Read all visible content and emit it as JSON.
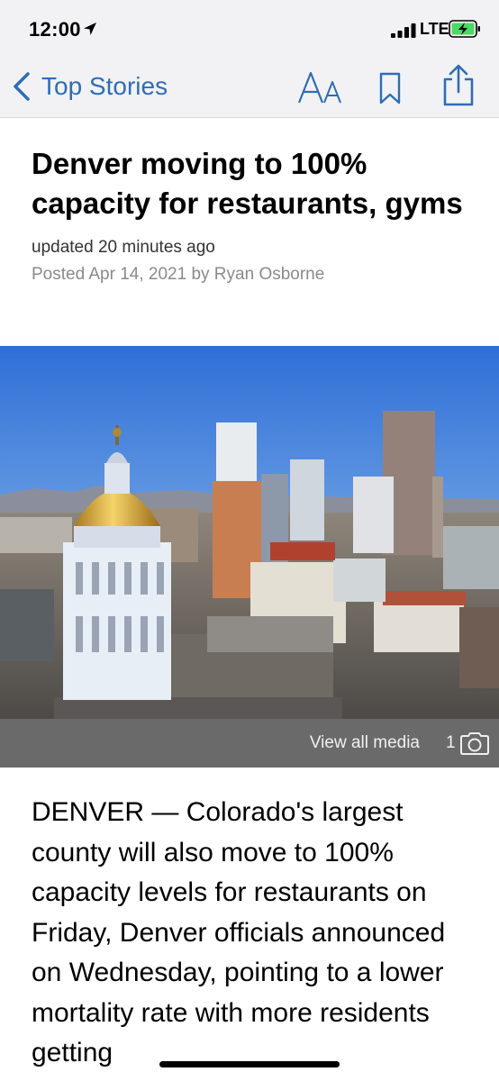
{
  "status_bar": {
    "time": "12:00",
    "network": "LTE",
    "icons": [
      "location-arrow-icon",
      "signal-icon",
      "battery-charging-icon"
    ]
  },
  "nav": {
    "back_label": "Top Stories",
    "font_size_label": "AA",
    "icons": [
      "chevron-left-icon",
      "font-size-icon",
      "bookmark-icon",
      "share-icon"
    ],
    "accent_color": "#2f6db5"
  },
  "article": {
    "headline": "Denver moving to 100% capacity for restaurants, gyms",
    "updated": "updated 20 minutes ago",
    "posted": "Posted Apr 14, 2021 by Ryan Osborne",
    "body": "DENVER — Colorado's largest county will also move to 100% capacity levels for restaurants on Friday, Denver officials announced on Wednesday, pointing to a lower mortality rate with more residents getting"
  },
  "media": {
    "view_all_label": "View all media",
    "count": "1",
    "icon": "camera-icon"
  }
}
